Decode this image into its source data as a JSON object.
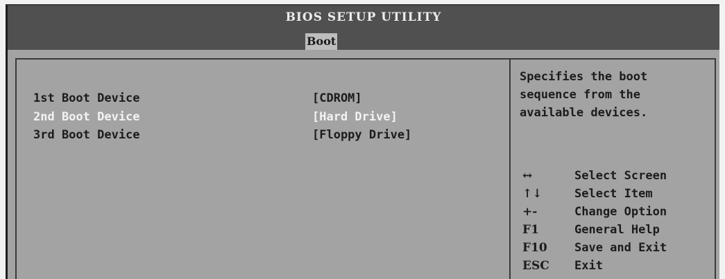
{
  "app_title": "BIOS SETUP UTILITY",
  "active_tab": "Boot",
  "boot_devices": [
    {
      "label": "1st Boot Device",
      "value": "[CDROM]",
      "selected": false
    },
    {
      "label": "2nd Boot Device",
      "value": "[Hard Drive]",
      "selected": true
    },
    {
      "label": "3rd Boot Device",
      "value": "[Floppy Drive]",
      "selected": false
    }
  ],
  "help": {
    "lines": [
      "Specifies the boot",
      "sequence from the",
      "available devices."
    ]
  },
  "key_legend": [
    {
      "key": "↔",
      "action": "Select Screen",
      "icon": "left-right-arrow-icon"
    },
    {
      "key": "↑↓",
      "action": "Select Item",
      "icon": "up-down-arrow-icon"
    },
    {
      "key": "+-",
      "action": "Change Option",
      "icon": "plus-minus-icon"
    },
    {
      "key": "F1",
      "action": "General Help"
    },
    {
      "key": "F10",
      "action": "Save and Exit"
    },
    {
      "key": "ESC",
      "action": "Exit"
    }
  ],
  "colors": {
    "title_bar": "#505050",
    "panel_bg": "#a3a3a3",
    "selected_text": "#f3f3f3",
    "text": "#1c1c1c"
  }
}
